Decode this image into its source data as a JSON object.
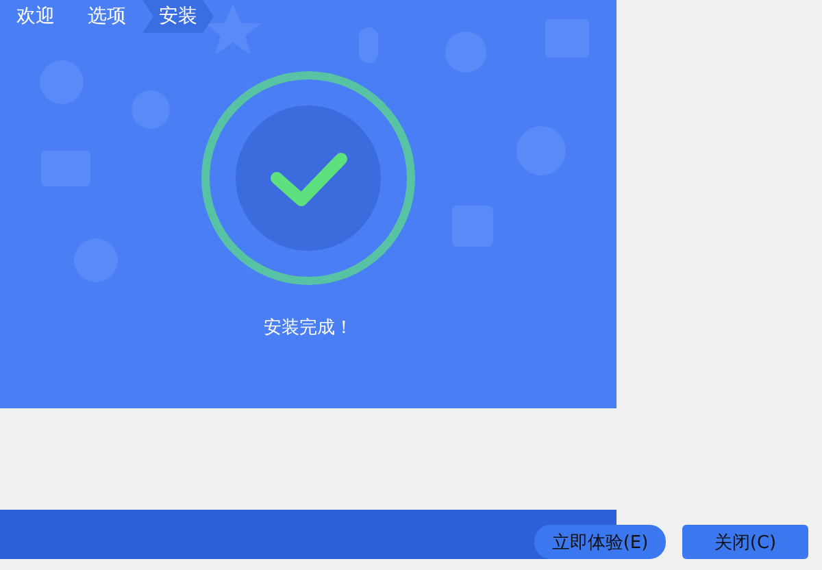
{
  "steps": [
    {
      "label": "欢迎",
      "selected": false
    },
    {
      "label": "选项",
      "selected": false
    },
    {
      "label": "安装",
      "selected": true
    }
  ],
  "status": {
    "message": "安装完成！"
  },
  "buttons": [
    {
      "label": "立即体验(E)"
    },
    {
      "label": "关闭(C)"
    }
  ]
}
